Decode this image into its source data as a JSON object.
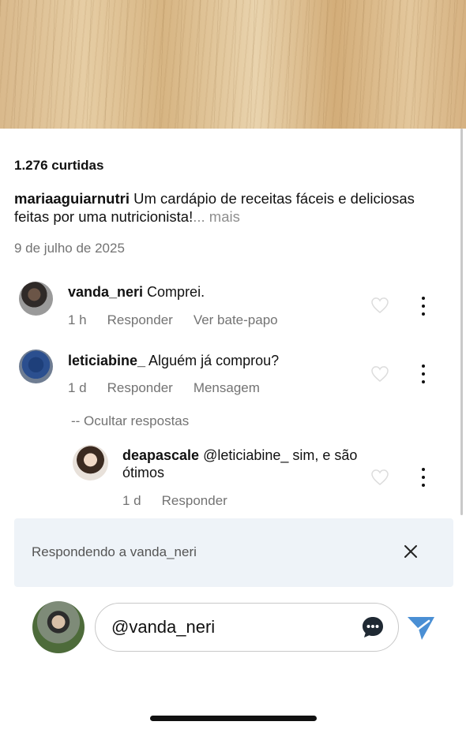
{
  "post": {
    "likes": "1.276 curtidas",
    "caption_user": "mariaaguiarnutri",
    "caption_text": " Um cardápio de receitas fáceis e deliciosas feitas por uma nutricionista!",
    "caption_more": "... mais",
    "date": "9 de julho de 2025"
  },
  "comments": [
    {
      "user": "vanda_neri",
      "text": " Comprei.",
      "time": "1 h",
      "reply": "Responder",
      "action": "Ver bate-papo"
    },
    {
      "user": "leticiabine_",
      "text": " Alguém já comprou?",
      "time": "1 d",
      "reply": "Responder",
      "action": "Mensagem"
    }
  ],
  "hide_replies": "-- Ocultar respostas",
  "replies": [
    {
      "user": "deapascale",
      "text": " @leticiabine_ sim, e são ótimos",
      "time": "1 d",
      "reply": "Responder"
    }
  ],
  "reply_bar": {
    "label": "Respondendo a vanda_neri"
  },
  "composer": {
    "value": "@vanda_neri"
  },
  "icons": {
    "heart": "heart-icon",
    "more": "more-options-icon",
    "close": "close-icon",
    "chat": "chat-bubble-icon",
    "send": "send-icon"
  },
  "colors": {
    "send": "#4a8fd4",
    "secondary_text": "#737373",
    "reply_bar_bg": "#eef3f8"
  }
}
